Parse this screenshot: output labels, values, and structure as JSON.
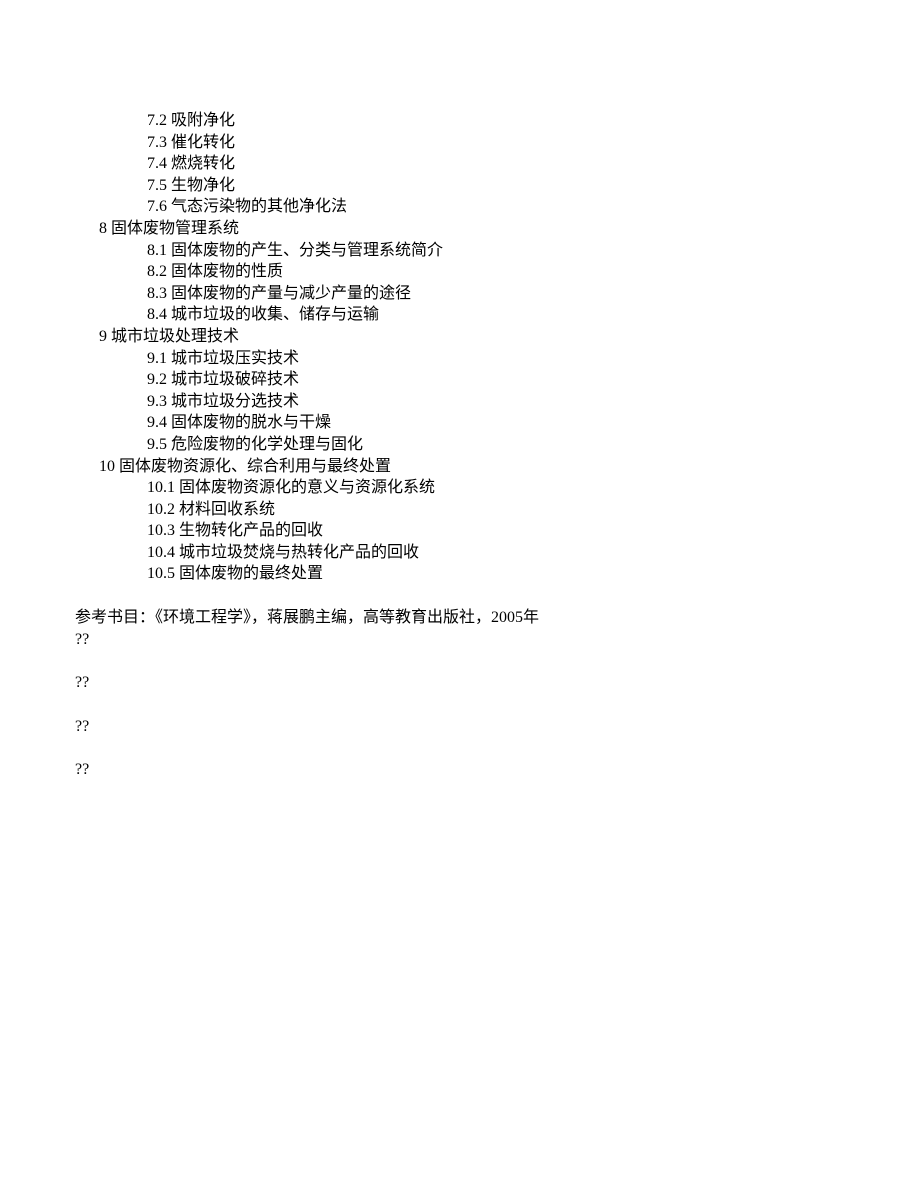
{
  "items": {
    "i7_2": "7.2 吸附净化",
    "i7_3": "7.3 催化转化",
    "i7_4": "7.4 燃烧转化",
    "i7_5": "7.5 生物净化",
    "i7_6": "7.6 气态污染物的其他净化法"
  },
  "section8": {
    "heading": "8 固体废物管理系统",
    "i8_1": "8.1 固体废物的产生、分类与管理系统简介",
    "i8_2": "8.2 固体废物的性质",
    "i8_3": "8.3 固体废物的产量与减少产量的途径",
    "i8_4": "8.4 城市垃圾的收集、储存与运输"
  },
  "section9": {
    "heading": "9 城市垃圾处理技术",
    "i9_1": "9.1 城市垃圾压实技术",
    "i9_2": "9.2 城市垃圾破碎技术",
    "i9_3": "9.3 城市垃圾分选技术",
    "i9_4": "9.4 固体废物的脱水与干燥",
    "i9_5": "9.5 危险废物的化学处理与固化"
  },
  "section10": {
    "heading": "10 固体废物资源化、综合利用与最终处置",
    "i10_1": "10.1 固体废物资源化的意义与资源化系统",
    "i10_2": "10.2 材料回收系统",
    "i10_3": "10.3 生物转化产品的回收",
    "i10_4": "10.4 城市垃圾焚烧与热转化产品的回收",
    "i10_5": "10.5 固体废物的最终处置"
  },
  "reference": "参考书目：《环境工程学》，蒋展鹏主编，高等教育出版社，2005年",
  "qmark": "??"
}
